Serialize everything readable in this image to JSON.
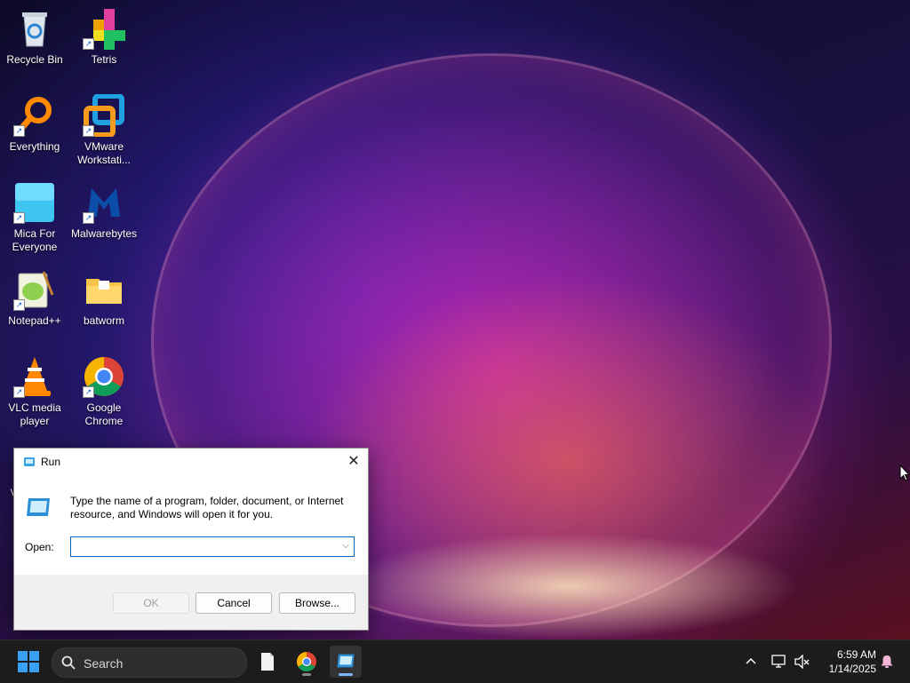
{
  "desktop": {
    "icons": [
      {
        "label": "Recycle Bin",
        "icon": "recycle-bin-icon"
      },
      {
        "label": "Tetris",
        "icon": "tetris-icon"
      },
      {
        "label": "Everything",
        "icon": "everything-search-icon"
      },
      {
        "label": "VMware Workstati...",
        "icon": "vmware-icon"
      },
      {
        "label": "Mica For Everyone",
        "icon": "mica-icon"
      },
      {
        "label": "Malwarebytes",
        "icon": "malwarebytes-icon"
      },
      {
        "label": "Notepad++",
        "icon": "notepad-plus-plus-icon"
      },
      {
        "label": "batworm",
        "icon": "folder-icon"
      },
      {
        "label": "VLC media player",
        "icon": "vlc-icon"
      },
      {
        "label": "Google Chrome",
        "icon": "chrome-icon"
      },
      {
        "label": "Vi",
        "icon": "partial-icon"
      }
    ]
  },
  "run_dialog": {
    "title": "Run",
    "description": "Type the name of a program, folder, document, or Internet resource, and Windows will open it for you.",
    "open_label": "Open:",
    "open_value": "",
    "ok_label": "OK",
    "cancel_label": "Cancel",
    "browse_label": "Browse..."
  },
  "taskbar": {
    "search_placeholder": "Search",
    "apps": [
      "file-explorer-icon",
      "chrome-icon",
      "run-icon"
    ],
    "time": "6:59 AM",
    "date": "1/14/2025"
  },
  "colors": {
    "accent": "#0067c0",
    "taskbar": "#1c1c1c",
    "start_blue": "#3aa0f4"
  }
}
